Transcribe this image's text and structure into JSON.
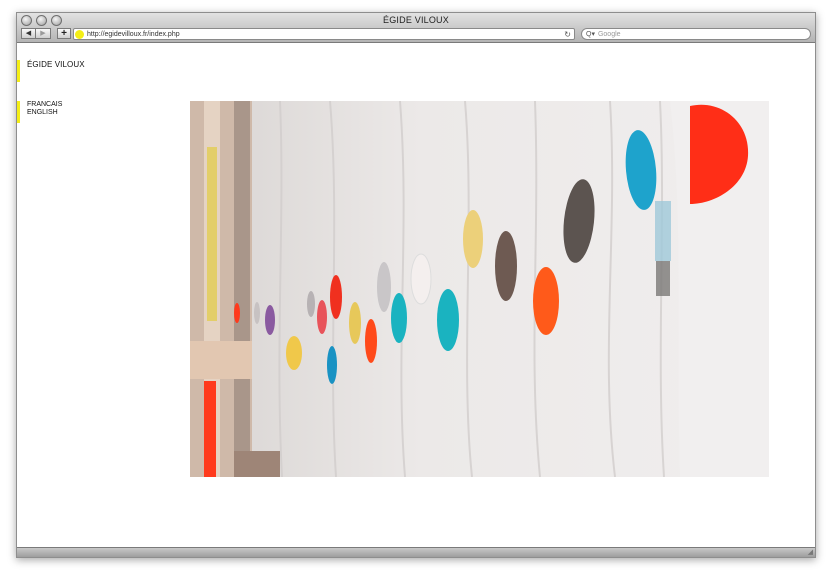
{
  "window": {
    "title": "ÉGIDE VILOUX"
  },
  "toolbar": {
    "back_icon": "◀",
    "forward_icon": "▶",
    "add_icon": "+",
    "url": "http://egidevilloux.fr/index.php",
    "reload_icon": "↻",
    "search_icon": "Q▾",
    "search_placeholder": "Google"
  },
  "site": {
    "title": "ÉGIDE VILOUX",
    "languages": [
      "FRANCAIS",
      "ENGLISH"
    ],
    "accent_color": "#f4ee16"
  },
  "photo": {
    "subject": "white fabric curtain with painted colored blobs",
    "blob_colors": [
      "#ff2e17",
      "#1ea3cc",
      "#5c5450",
      "#ecd07a",
      "#6e5a52",
      "#ff5a1a",
      "#1ab3c0",
      "#e8373a",
      "#c9c6c8",
      "#d9c24d",
      "#8a5aa0"
    ]
  }
}
